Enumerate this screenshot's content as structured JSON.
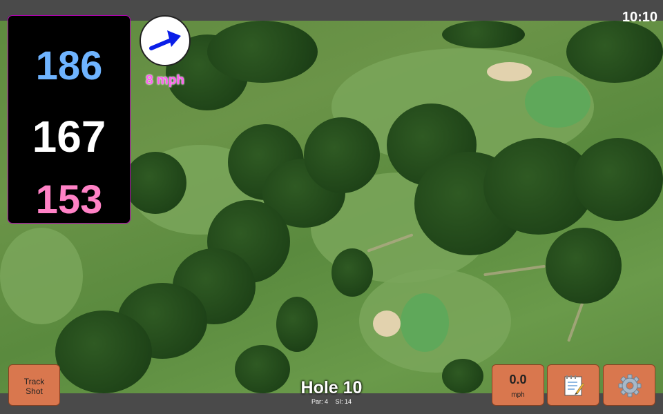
{
  "status_bar": {
    "time": "10:10"
  },
  "distances": {
    "back": "186",
    "middle": "167",
    "front": "153"
  },
  "colors": {
    "back": "#6fb4ff",
    "middle": "#ffffff",
    "front": "#ff82c6",
    "wind_text": "#ff5cf0",
    "button": "#d9774e",
    "wind_arrow": "#0a1ee8"
  },
  "wind": {
    "speed_label": "8 mph",
    "icon": "arrow-icon"
  },
  "hole": {
    "title": "Hole 10",
    "par": "Par: 4",
    "si": "SI: 14"
  },
  "buttons": {
    "track_shot": {
      "line1": "Track",
      "line2": "Shot"
    },
    "speed": {
      "value": "0.0",
      "unit": "mph"
    },
    "notes": {
      "icon": "notepad-icon"
    },
    "settings": {
      "icon": "gear-icon"
    }
  }
}
